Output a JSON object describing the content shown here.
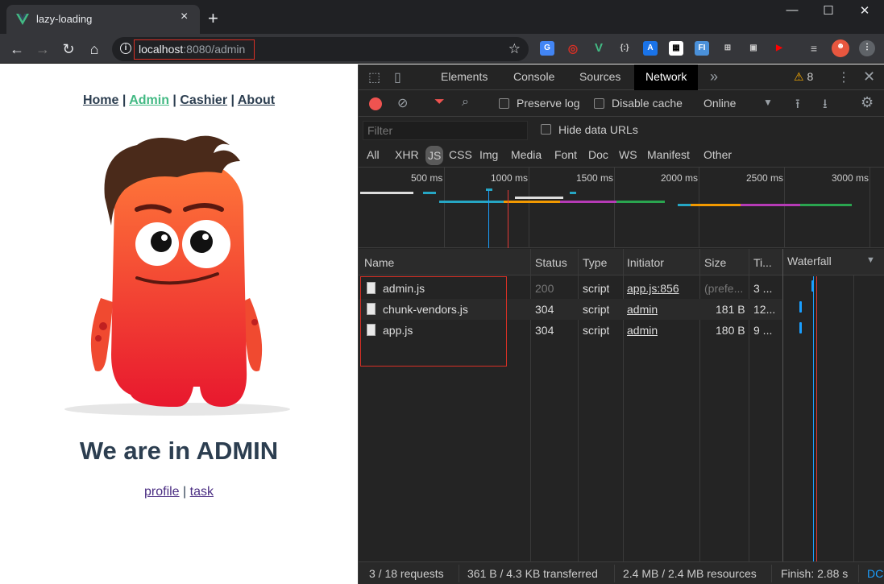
{
  "browser": {
    "tab_title": "lazy-loading",
    "tab_close": "×",
    "new_tab": "+",
    "url_host": "localhost",
    "url_path": ":8080/admin",
    "window_controls": [
      "—",
      "☐",
      "✕"
    ]
  },
  "page": {
    "nav": [
      "Home",
      "Admin",
      "Cashier",
      "About"
    ],
    "nav_separator": "|",
    "active_nav": "Admin",
    "heading": "We are in ADMIN",
    "subnav": [
      "profile",
      "task"
    ],
    "accent_color": "#42b983",
    "text_color": "#2c3e50"
  },
  "devtools": {
    "tabs": [
      "Elements",
      "Console",
      "Sources",
      "Network"
    ],
    "active_tab": "Network",
    "more_tabs": "»",
    "warning_count": "8",
    "toolbar": {
      "preserve_log": "Preserve log",
      "disable_cache": "Disable cache",
      "throttling": "Online"
    },
    "filter_placeholder": "Filter",
    "hide_data_urls": "Hide data URLs",
    "type_filters": [
      "All",
      "XHR",
      "JS",
      "CSS",
      "Img",
      "Media",
      "Font",
      "Doc",
      "WS",
      "Manifest",
      "Other"
    ],
    "active_type": "JS",
    "timeline_labels": [
      "500 ms",
      "1000 ms",
      "1500 ms",
      "2000 ms",
      "2500 ms",
      "3000 ms"
    ],
    "columns": [
      "Name",
      "Status",
      "Type",
      "Initiator",
      "Size",
      "Ti...",
      "Waterfall"
    ],
    "rows": [
      {
        "name": "admin.js",
        "status": "200",
        "type": "script",
        "initiator": "app.js:856",
        "size": "(prefe...",
        "time": "3 ..."
      },
      {
        "name": "chunk-vendors.js",
        "status": "304",
        "type": "script",
        "initiator": "admin",
        "size": "181 B",
        "time": "12..."
      },
      {
        "name": "app.js",
        "status": "304",
        "type": "script",
        "initiator": "admin",
        "size": "180 B",
        "time": "9 ..."
      }
    ],
    "status_bar": {
      "requests": "3 / 18 requests",
      "transferred": "361 B / 4.3 KB transferred",
      "resources": "2.4 MB / 2.4 MB resources",
      "finish": "Finish: 2.88 s",
      "dcl": "DC"
    }
  }
}
